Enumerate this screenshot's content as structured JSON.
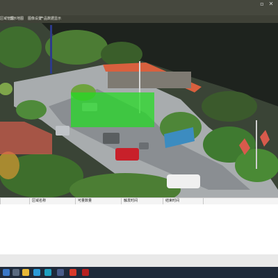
{
  "menu": {
    "items": [
      {
        "label": "区域管理"
      },
      {
        "label": "显示地图"
      },
      {
        "label": "图像设置"
      },
      {
        "label": "产品数据显示"
      }
    ]
  },
  "table": {
    "columns": [
      "区域名称",
      "可量数量",
      "触发时间",
      "结束时间"
    ],
    "rows": []
  },
  "overlay": {
    "detection_color": "#22dd22",
    "zone_color": "#e06050"
  },
  "taskbar": {
    "icons": [
      "start-icon",
      "search-icon",
      "task-view-icon",
      "file-explorer-icon",
      "browser-icon",
      "media-player-icon",
      "pdf-reader-icon",
      "acrobat-icon"
    ]
  }
}
